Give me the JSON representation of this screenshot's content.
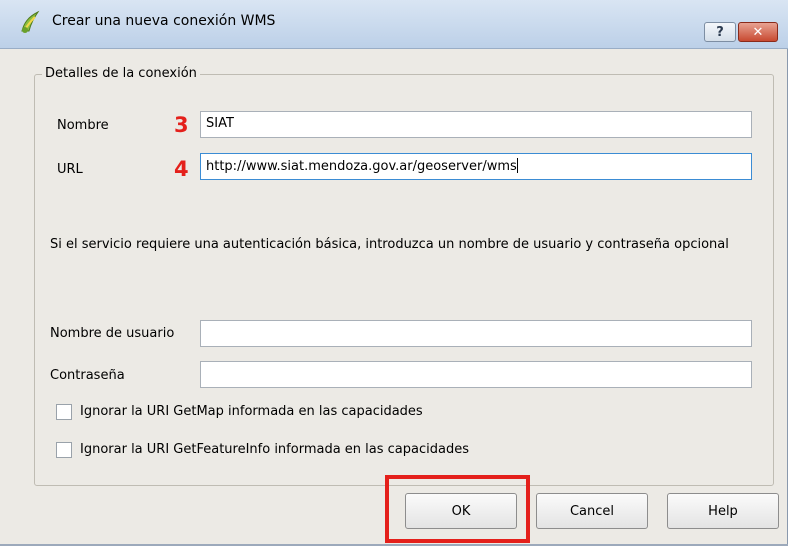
{
  "window": {
    "title": "Crear una nueva conexión WMS",
    "help_label": "?",
    "close_label": "✕"
  },
  "group": {
    "title": "Detalles de la conexión"
  },
  "form": {
    "name_label": "Nombre",
    "name_value": "SIAT",
    "url_label": "URL",
    "url_value": "http://www.siat.mendoza.gov.ar/geoserver/wms",
    "info_text": "Si el servicio requiere una autenticación básica, introduzca un nombre de usuario y contraseña opcional",
    "username_label": "Nombre de usuario",
    "username_value": "",
    "password_label": "Contraseña",
    "password_value": "",
    "check_getmap_label": "Ignorar la URI GetMap informada en las capacidades",
    "check_getmap_checked": false,
    "check_getfeatureinfo_label": "Ignorar la URI GetFeatureInfo informada en las capacidades",
    "check_getfeatureinfo_checked": false
  },
  "annotations": {
    "marker_name": "3",
    "marker_url": "4"
  },
  "buttons": {
    "ok": "OK",
    "cancel": "Cancel",
    "help": "Help"
  },
  "colors": {
    "annotation_red": "#e4201b",
    "focus_blue": "#3b8cd4",
    "title_bar": "#bcd0e8"
  }
}
